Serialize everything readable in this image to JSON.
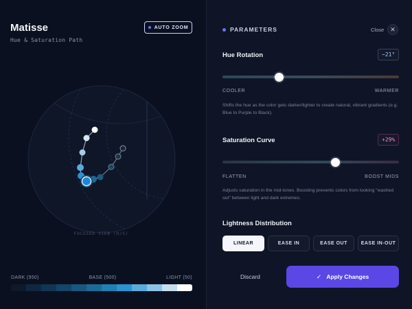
{
  "app": {
    "title": "Matisse",
    "subtitle": "Hue & Saturation Path"
  },
  "auto_zoom": {
    "label": "AUTO ZOOM"
  },
  "visualization": {
    "focus_label": "FOCUSED VIEW (H/S)"
  },
  "scale": {
    "dark_label": "DARK (950)",
    "base_label": "BASE (500)",
    "light_label": "LIGHT (50)",
    "swatches": [
      "#0c1a2c",
      "#0f2740",
      "#123553",
      "#154568",
      "#18577f",
      "#1b6b98",
      "#1f80b3",
      "#2b93cf",
      "#5aaadb",
      "#8ec2e4",
      "#c6def0",
      "#ffffff"
    ]
  },
  "panel": {
    "heading": "PARAMETERS",
    "close_label": "Close",
    "hue": {
      "title": "Hue Rotation",
      "value": "−21°",
      "fraction": 0.32,
      "min_label": "COOLER",
      "max_label": "WARMER",
      "description": "Shifts the hue as the color gets darker/lighter to create natural, vibrant gradients (e.g. Blue to Purple to Black)."
    },
    "saturation": {
      "title": "Saturation Curve",
      "value": "+29%",
      "fraction": 0.64,
      "min_label": "FLATTEN",
      "max_label": "BOOST MIDS",
      "description": "Adjusts saturation in the mid-tones. Boosting prevents colors from looking \"washed out\" between light and dark extremes."
    },
    "lightness": {
      "title": "Lightness Distribution",
      "options": [
        "LINEAR",
        "EASE IN",
        "EASE OUT",
        "EASE IN-OUT"
      ],
      "selected": "LINEAR"
    },
    "discard_label": "Discard",
    "apply_label": "Apply Changes"
  },
  "colors": {
    "accent": "#5b47e6",
    "accent_dot": "#6a72ff",
    "hue_badge_text": "#a8c7ff",
    "sat_badge_text": "#ff7fc8"
  }
}
